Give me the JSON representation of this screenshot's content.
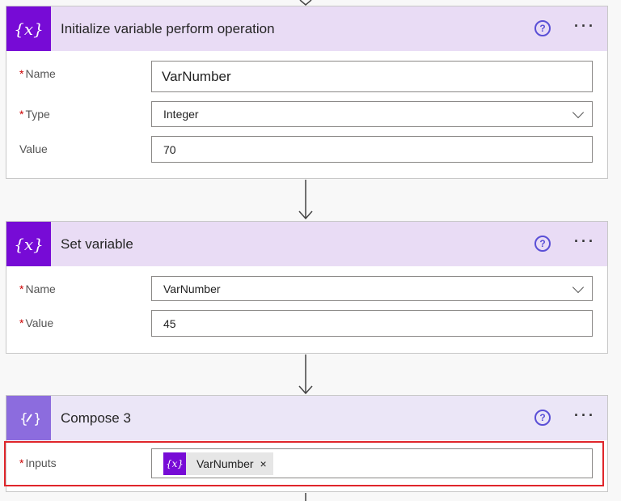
{
  "cards": [
    {
      "title": "Initialize variable perform operation",
      "icon": "variable-icon",
      "fields": [
        {
          "label": "Name",
          "required": "*",
          "value": "VarNumber"
        },
        {
          "label": "Type",
          "required": "*",
          "value": "Integer"
        },
        {
          "label": "Value",
          "required": "",
          "value": "70"
        }
      ]
    },
    {
      "title": "Set variable",
      "icon": "variable-icon",
      "fields": [
        {
          "label": "Name",
          "required": "*",
          "value": "VarNumber"
        },
        {
          "label": "Value",
          "required": "*",
          "value": "45"
        }
      ]
    },
    {
      "title": "Compose 3",
      "icon": "compose-icon",
      "fields": [
        {
          "label": "Inputs",
          "required": "*",
          "token": "VarNumber",
          "token_remove": "×"
        }
      ]
    }
  ],
  "icons": {
    "variable": "{x}",
    "token_variable": "{x}",
    "compose": "{⁄}",
    "help": "?",
    "more": "···"
  },
  "colors": {
    "variable_icon_bg": "#770bd6",
    "compose_icon_bg": "#8c6cde",
    "highlight": "#e0262b"
  }
}
